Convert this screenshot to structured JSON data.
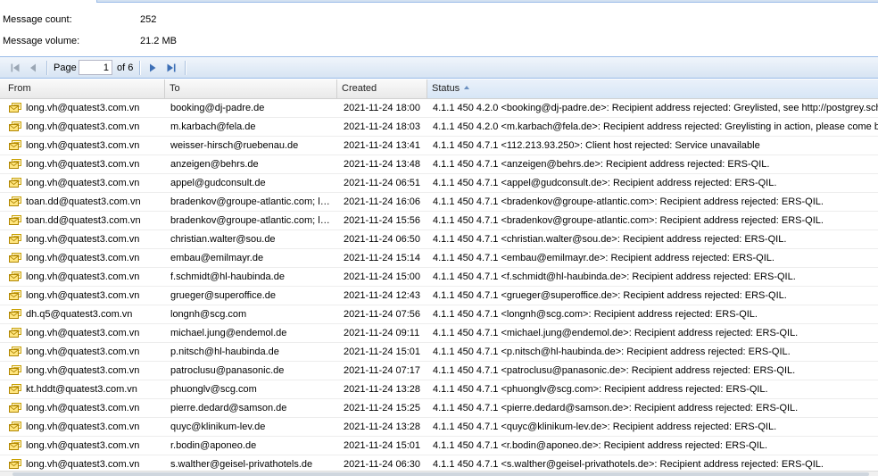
{
  "stats": {
    "message_count_label": "Message count:",
    "message_count_value": "252",
    "message_volume_label": "Message volume:",
    "message_volume_value": "21.2 MB"
  },
  "paging": {
    "page_label": "Page",
    "current_page": "1",
    "of_label": "of 6"
  },
  "columns": {
    "from": "From",
    "to": "To",
    "created": "Created",
    "status": "Status"
  },
  "colors": {
    "accent": "#99bbe8",
    "icon_blue": "#3c6fb6"
  },
  "rows": [
    {
      "from": "long.vh@quatest3.com.vn",
      "to": "booking@dj-padre.de",
      "created": "2021-11-24 18:00",
      "status": "4.1.1 450 4.2.0 <booking@dj-padre.de>: Recipient address rejected: Greylisted, see http://postgrey.sch"
    },
    {
      "from": "long.vh@quatest3.com.vn",
      "to": "m.karbach@fela.de",
      "created": "2021-11-24 18:03",
      "status": "4.1.1 450 4.2.0 <m.karbach@fela.de>: Recipient address rejected: Greylisting in action, please come b"
    },
    {
      "from": "long.vh@quatest3.com.vn",
      "to": "weisser-hirsch@ruebenau.de",
      "created": "2021-11-24 13:41",
      "status": "4.1.1 450 4.7.1 <112.213.93.250>: Client host rejected: Service unavailable"
    },
    {
      "from": "long.vh@quatest3.com.vn",
      "to": "anzeigen@behrs.de",
      "created": "2021-11-24 13:48",
      "status": "4.1.1 450 4.7.1 <anzeigen@behrs.de>: Recipient address rejected: ERS-QIL."
    },
    {
      "from": "long.vh@quatest3.com.vn",
      "to": "appel@gudconsult.de",
      "created": "2021-11-24 06:51",
      "status": "4.1.1 450 4.7.1 <appel@gudconsult.de>: Recipient address rejected: ERS-QIL."
    },
    {
      "from": "toan.dd@quatest3.com.vn",
      "to": "bradenkov@groupe-atlantic.com; l…",
      "created": "2021-11-24 16:06",
      "status": "4.1.1 450 4.7.1 <bradenkov@groupe-atlantic.com>: Recipient address rejected: ERS-QIL."
    },
    {
      "from": "toan.dd@quatest3.com.vn",
      "to": "bradenkov@groupe-atlantic.com; l…",
      "created": "2021-11-24 15:56",
      "status": "4.1.1 450 4.7.1 <bradenkov@groupe-atlantic.com>: Recipient address rejected: ERS-QIL."
    },
    {
      "from": "long.vh@quatest3.com.vn",
      "to": "christian.walter@sou.de",
      "created": "2021-11-24 06:50",
      "status": "4.1.1 450 4.7.1 <christian.walter@sou.de>: Recipient address rejected: ERS-QIL."
    },
    {
      "from": "long.vh@quatest3.com.vn",
      "to": "embau@emilmayr.de",
      "created": "2021-11-24 15:14",
      "status": "4.1.1 450 4.7.1 <embau@emilmayr.de>: Recipient address rejected: ERS-QIL."
    },
    {
      "from": "long.vh@quatest3.com.vn",
      "to": "f.schmidt@hl-haubinda.de",
      "created": "2021-11-24 15:00",
      "status": "4.1.1 450 4.7.1 <f.schmidt@hl-haubinda.de>: Recipient address rejected: ERS-QIL."
    },
    {
      "from": "long.vh@quatest3.com.vn",
      "to": "grueger@superoffice.de",
      "created": "2021-11-24 12:43",
      "status": "4.1.1 450 4.7.1 <grueger@superoffice.de>: Recipient address rejected: ERS-QIL."
    },
    {
      "from": "dh.q5@quatest3.com.vn",
      "to": "longnh@scg.com",
      "created": "2021-11-24 07:56",
      "status": "4.1.1 450 4.7.1 <longnh@scg.com>: Recipient address rejected: ERS-QIL."
    },
    {
      "from": "long.vh@quatest3.com.vn",
      "to": "michael.jung@endemol.de",
      "created": "2021-11-24 09:11",
      "status": "4.1.1 450 4.7.1 <michael.jung@endemol.de>: Recipient address rejected: ERS-QIL."
    },
    {
      "from": "long.vh@quatest3.com.vn",
      "to": "p.nitsch@hl-haubinda.de",
      "created": "2021-11-24 15:01",
      "status": "4.1.1 450 4.7.1 <p.nitsch@hl-haubinda.de>: Recipient address rejected: ERS-QIL."
    },
    {
      "from": "long.vh@quatest3.com.vn",
      "to": "patroclusu@panasonic.de",
      "created": "2021-11-24 07:17",
      "status": "4.1.1 450 4.7.1 <patroclusu@panasonic.de>: Recipient address rejected: ERS-QIL."
    },
    {
      "from": "kt.hddt@quatest3.com.vn",
      "to": "phuonglv@scg.com",
      "created": "2021-11-24 13:28",
      "status": "4.1.1 450 4.7.1 <phuonglv@scg.com>: Recipient address rejected: ERS-QIL."
    },
    {
      "from": "long.vh@quatest3.com.vn",
      "to": "pierre.dedard@samson.de",
      "created": "2021-11-24 15:25",
      "status": "4.1.1 450 4.7.1 <pierre.dedard@samson.de>: Recipient address rejected: ERS-QIL."
    },
    {
      "from": "long.vh@quatest3.com.vn",
      "to": "quyc@klinikum-lev.de",
      "created": "2021-11-24 13:28",
      "status": "4.1.1 450 4.7.1 <quyc@klinikum-lev.de>: Recipient address rejected: ERS-QIL."
    },
    {
      "from": "long.vh@quatest3.com.vn",
      "to": "r.bodin@aponeo.de",
      "created": "2021-11-24 15:01",
      "status": "4.1.1 450 4.7.1 <r.bodin@aponeo.de>: Recipient address rejected: ERS-QIL."
    },
    {
      "from": "long.vh@quatest3.com.vn",
      "to": "s.walther@geisel-privathotels.de",
      "created": "2021-11-24 06:30",
      "status": "4.1.1 450 4.7.1 <s.walther@geisel-privathotels.de>: Recipient address rejected: ERS-QIL."
    }
  ]
}
